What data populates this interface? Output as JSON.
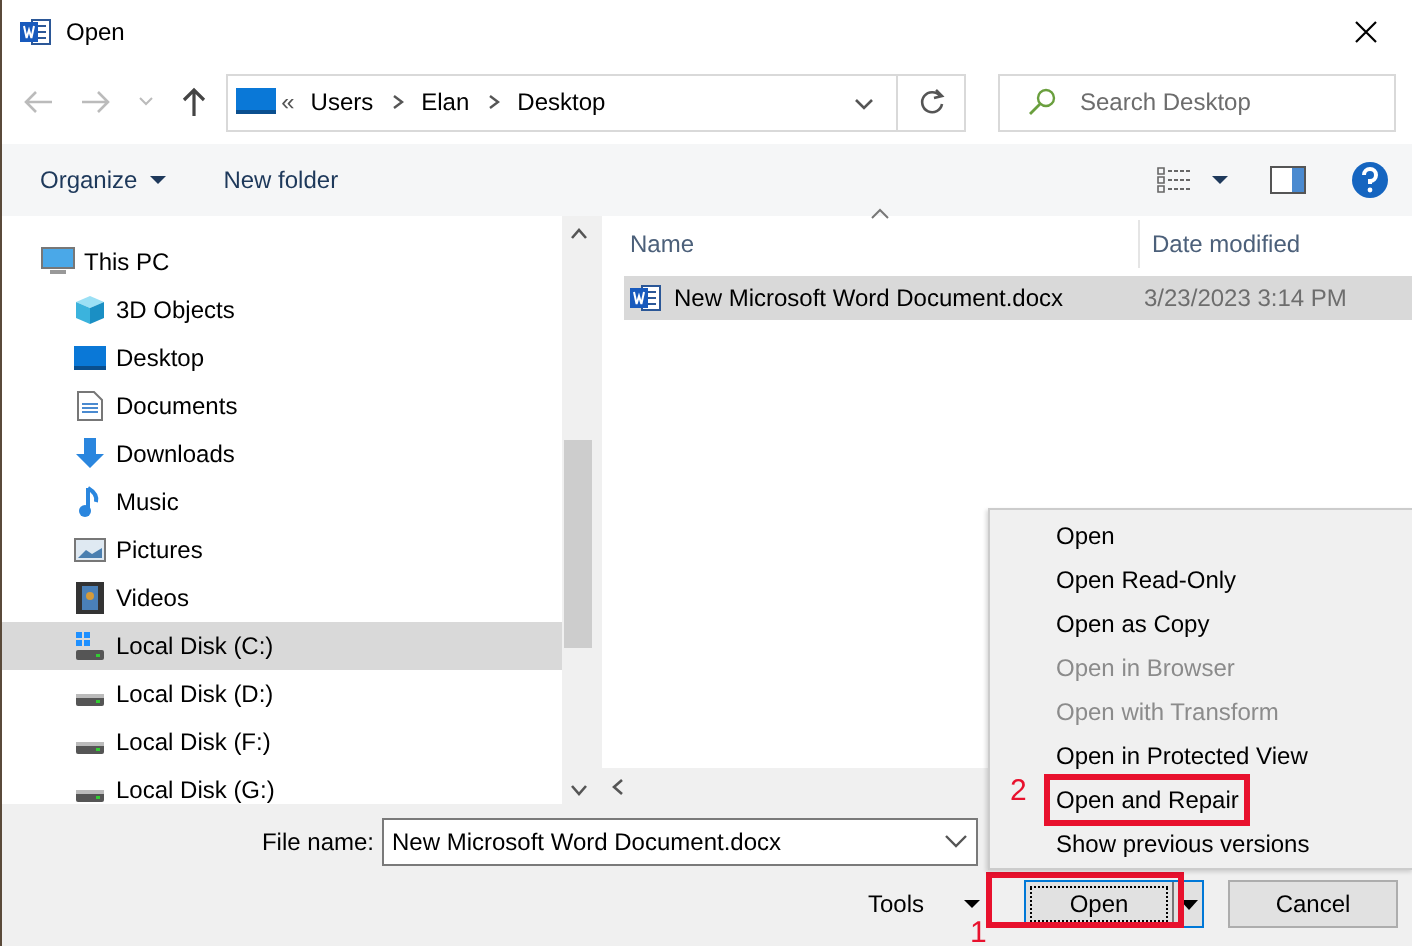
{
  "window": {
    "title": "Open"
  },
  "address_bar": {
    "overflow": "«",
    "path": [
      "Users",
      "Elan",
      "Desktop"
    ]
  },
  "search": {
    "placeholder": "Search Desktop"
  },
  "toolbar": {
    "organize": "Organize",
    "new_folder": "New folder"
  },
  "navigation_tree": [
    {
      "label": "This PC",
      "kind": "pc",
      "selected": false,
      "children": [
        {
          "label": "3D Objects",
          "kind": "cube",
          "selected": false
        },
        {
          "label": "Desktop",
          "kind": "desktop",
          "selected": false
        },
        {
          "label": "Documents",
          "kind": "documents",
          "selected": false
        },
        {
          "label": "Downloads",
          "kind": "downloads",
          "selected": false
        },
        {
          "label": "Music",
          "kind": "music",
          "selected": false
        },
        {
          "label": "Pictures",
          "kind": "pictures",
          "selected": false
        },
        {
          "label": "Videos",
          "kind": "videos",
          "selected": false
        },
        {
          "label": "Local Disk (C:)",
          "kind": "system-disk",
          "selected": true
        },
        {
          "label": "Local Disk (D:)",
          "kind": "disk",
          "selected": false
        },
        {
          "label": "Local Disk (F:)",
          "kind": "disk",
          "selected": false
        },
        {
          "label": "Local Disk (G:)",
          "kind": "disk",
          "selected": false
        }
      ]
    }
  ],
  "file_list": {
    "columns": [
      "Name",
      "Date modified"
    ],
    "rows": [
      {
        "name": "New Microsoft Word Document.docx",
        "date_modified": "3/23/2023 3:14 PM",
        "selected": true
      }
    ]
  },
  "file_name": {
    "label": "File name:",
    "value": "New Microsoft Word Document.docx"
  },
  "tools": "Tools",
  "open_button": {
    "label": "Open",
    "annotation": "1"
  },
  "cancel_button": "Cancel",
  "open_menu": [
    {
      "label": "Open",
      "disabled": false
    },
    {
      "label": "Open Read-Only",
      "disabled": false
    },
    {
      "label": "Open as Copy",
      "disabled": false
    },
    {
      "label": "Open in Browser",
      "disabled": true
    },
    {
      "label": "Open with Transform",
      "disabled": true
    },
    {
      "label": "Open in Protected View",
      "disabled": false
    },
    {
      "label": "Open and Repair",
      "disabled": false,
      "annotation": "2"
    },
    {
      "label": "Show previous versions",
      "disabled": false
    }
  ]
}
